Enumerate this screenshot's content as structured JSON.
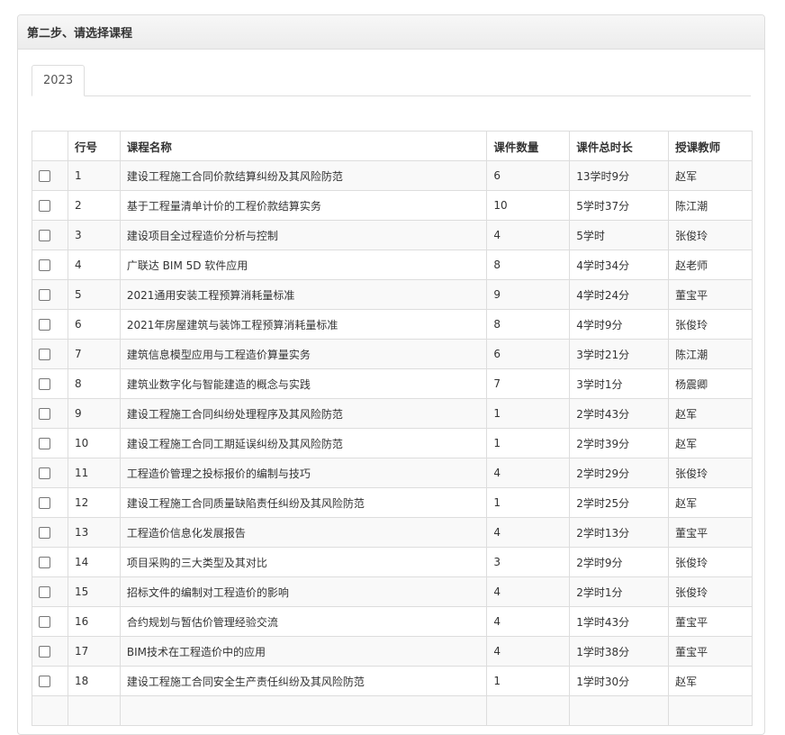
{
  "panel": {
    "title": "第二步、请选择课程"
  },
  "tabs": [
    {
      "label": "2023",
      "active": true
    }
  ],
  "table": {
    "headers": {
      "no": "行号",
      "name": "课程名称",
      "count": "课件数量",
      "duration": "课件总时长",
      "teacher": "授课教师"
    },
    "rows": [
      {
        "no": "1",
        "name": "建设工程施工合同价款结算纠纷及其风险防范",
        "count": "6",
        "duration": "13学时9分",
        "teacher": "赵军"
      },
      {
        "no": "2",
        "name": "基于工程量清单计价的工程价款结算实务",
        "count": "10",
        "duration": "5学时37分",
        "teacher": "陈江潮"
      },
      {
        "no": "3",
        "name": "建设项目全过程造价分析与控制",
        "count": "4",
        "duration": "5学时",
        "teacher": "张俊玲"
      },
      {
        "no": "4",
        "name": "广联达 BIM 5D 软件应用",
        "count": "8",
        "duration": "4学时34分",
        "teacher": "赵老师"
      },
      {
        "no": "5",
        "name": "2021通用安装工程预算消耗量标准",
        "count": "9",
        "duration": "4学时24分",
        "teacher": "董宝平"
      },
      {
        "no": "6",
        "name": "2021年房屋建筑与装饰工程预算消耗量标准",
        "count": "8",
        "duration": "4学时9分",
        "teacher": "张俊玲"
      },
      {
        "no": "7",
        "name": "建筑信息模型应用与工程造价算量实务",
        "count": "6",
        "duration": "3学时21分",
        "teacher": "陈江潮"
      },
      {
        "no": "8",
        "name": "建筑业数字化与智能建造的概念与实践",
        "count": "7",
        "duration": "3学时1分",
        "teacher": "杨震卿"
      },
      {
        "no": "9",
        "name": "建设工程施工合同纠纷处理程序及其风险防范",
        "count": "1",
        "duration": "2学时43分",
        "teacher": "赵军"
      },
      {
        "no": "10",
        "name": "建设工程施工合同工期延误纠纷及其风险防范",
        "count": "1",
        "duration": "2学时39分",
        "teacher": "赵军"
      },
      {
        "no": "11",
        "name": "工程造价管理之投标报价的编制与技巧",
        "count": "4",
        "duration": "2学时29分",
        "teacher": "张俊玲"
      },
      {
        "no": "12",
        "name": "建设工程施工合同质量缺陷责任纠纷及其风险防范",
        "count": "1",
        "duration": "2学时25分",
        "teacher": "赵军"
      },
      {
        "no": "13",
        "name": "工程造价信息化发展报告",
        "count": "4",
        "duration": "2学时13分",
        "teacher": "董宝平"
      },
      {
        "no": "14",
        "name": "项目采购的三大类型及其对比",
        "count": "3",
        "duration": "2学时9分",
        "teacher": "张俊玲"
      },
      {
        "no": "15",
        "name": "招标文件的编制对工程造价的影响",
        "count": "4",
        "duration": "2学时1分",
        "teacher": "张俊玲"
      },
      {
        "no": "16",
        "name": "合约规划与暂估价管理经验交流",
        "count": "4",
        "duration": "1学时43分",
        "teacher": "董宝平"
      },
      {
        "no": "17",
        "name": "BIM技术在工程造价中的应用",
        "count": "4",
        "duration": "1学时38分",
        "teacher": "董宝平"
      },
      {
        "no": "18",
        "name": "建设工程施工合同安全生产责任纠纷及其风险防范",
        "count": "1",
        "duration": "1学时30分",
        "teacher": "赵军"
      },
      {
        "no": "",
        "name": "",
        "count": "",
        "duration": "",
        "teacher": ""
      }
    ]
  },
  "icons": {
    "checkbox": "checkbox-icon"
  }
}
